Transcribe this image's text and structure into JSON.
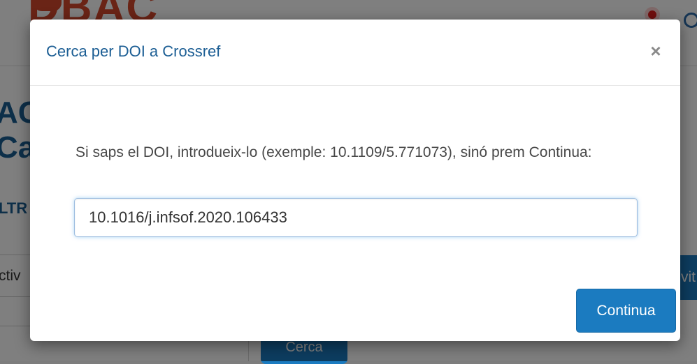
{
  "background": {
    "logo_text": "DBAC",
    "heading_line1": "AC",
    "heading_line2": "Ca",
    "filter_label": "LTR",
    "active_text": "ctiv",
    "search_button": "Cerca",
    "right_button_text": "vit"
  },
  "modal": {
    "title": "Cerca per DOI a Crossref",
    "close_label": "×",
    "message": "Si saps el DOI, introdueix-lo (exemple: 10.1109/5.771073), sinó prem Continua:",
    "doi_value": "10.1016/j.infsof.2020.106433",
    "continue_label": "Continua"
  },
  "colors": {
    "accent": "#1b7bc0",
    "title_blue": "#1c5e94",
    "logo_red": "#d5492c"
  }
}
